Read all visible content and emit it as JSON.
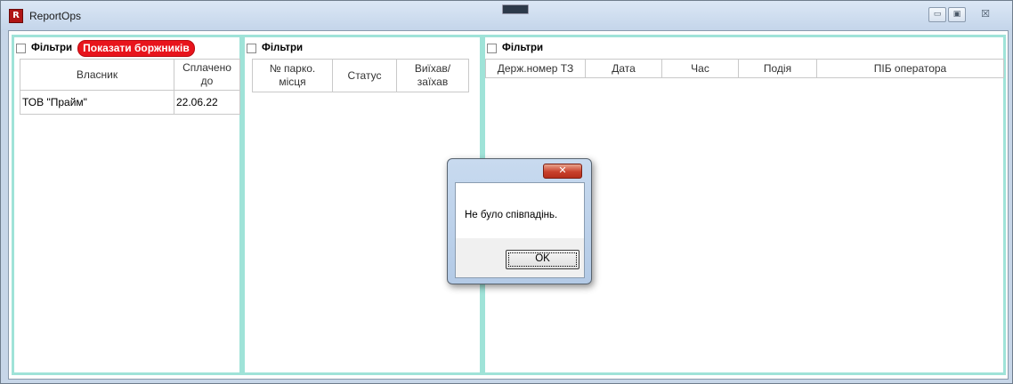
{
  "window": {
    "title": "ReportOps",
    "icon_letter": "R",
    "controls": {
      "minimize": "▭",
      "maximize": "▣",
      "close": "☒"
    }
  },
  "panels": {
    "owners": {
      "filter_label": "Фільтри",
      "debtors_button": "Показати боржників",
      "columns": [
        "Власник",
        "Сплачено до"
      ],
      "rows": [
        [
          "ТОВ \"Прайм\"",
          "22.06.22"
        ]
      ]
    },
    "places": {
      "filter_label": "Фільтри",
      "columns": [
        "№ парко. місця",
        "Статус",
        "Виїхав/ заїхав"
      ]
    },
    "events": {
      "filter_label": "Фільтри",
      "columns": [
        "Держ.номер ТЗ",
        "Дата",
        "Час",
        "Подія",
        "ПІБ оператора"
      ]
    }
  },
  "dialog": {
    "close_glyph": "✕",
    "message": "Не було співпадінь.",
    "ok_label": "OK"
  },
  "colors": {
    "panel_border": "#9fe3d8",
    "debtors_button": "#e8141c",
    "dialog_frame": "#b9cfe9"
  }
}
